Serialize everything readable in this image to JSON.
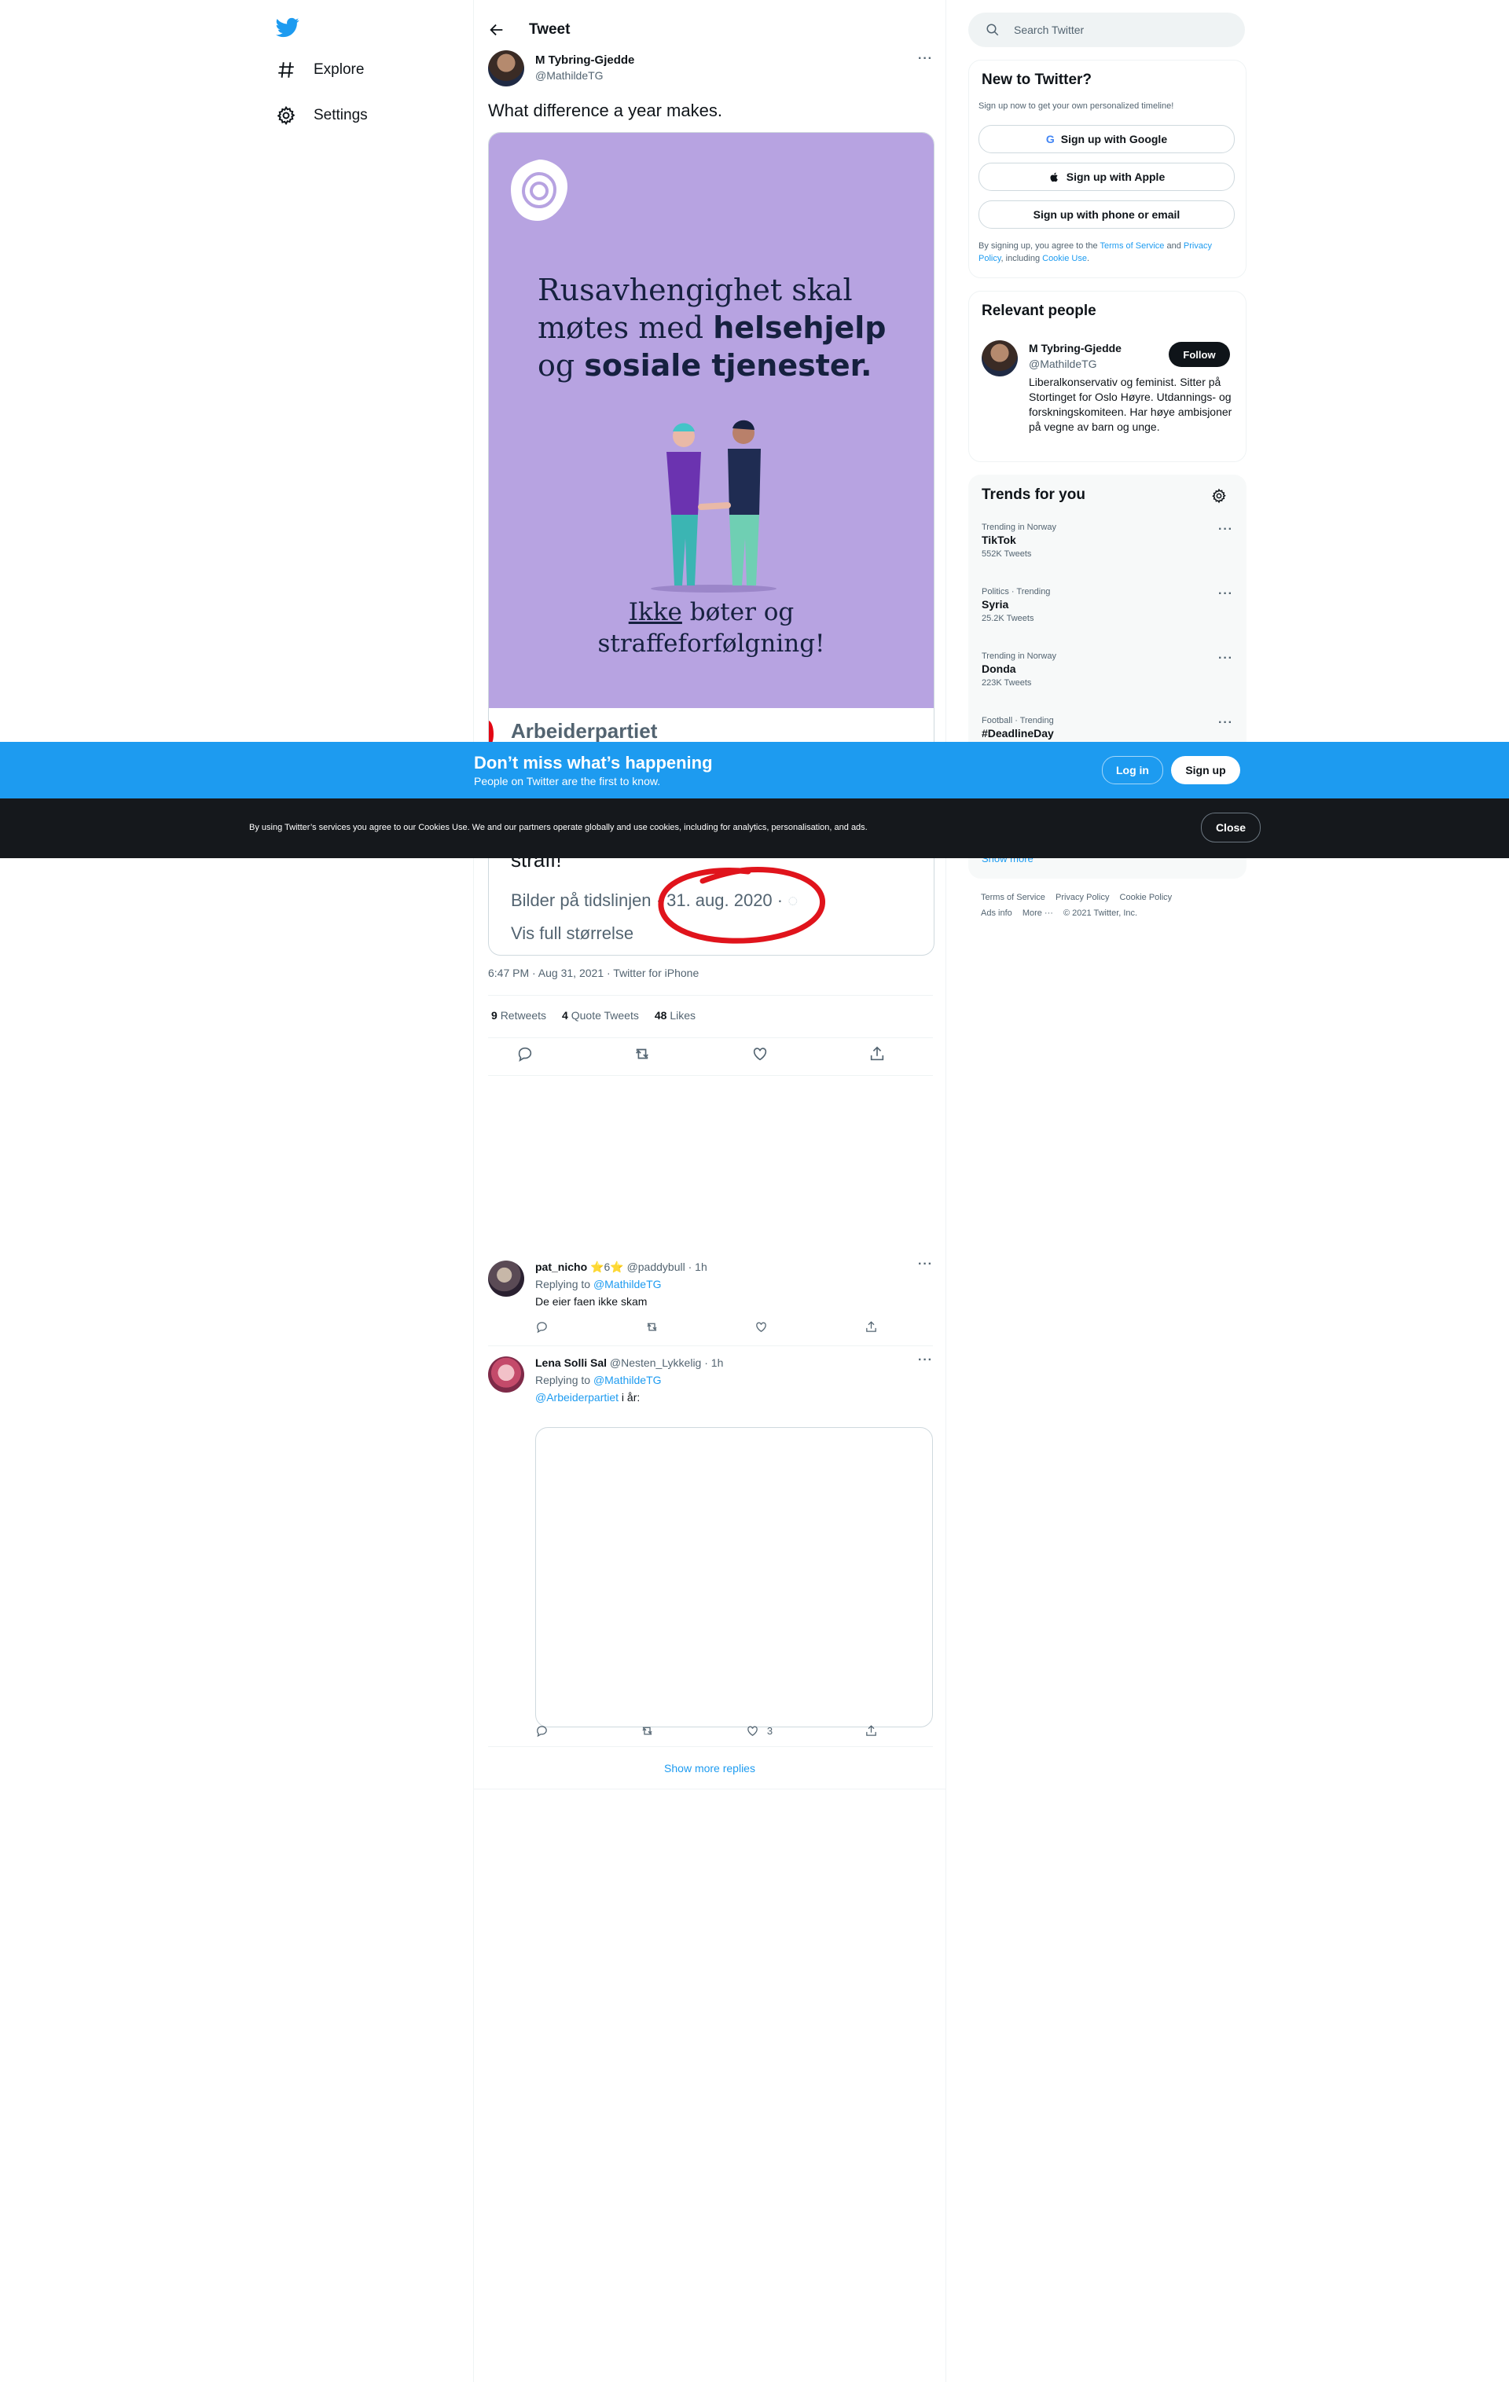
{
  "nav": {
    "explore": "Explore",
    "settings": "Settings"
  },
  "header": {
    "title": "Tweet"
  },
  "tweet": {
    "name": "M Tybring-Gjedde",
    "handle": "@MathildeTG",
    "text": "What difference a year makes.",
    "poster": {
      "line1": "Rusavhengighet skal",
      "line2a": "møtes med ",
      "line2b": "helsehjelp",
      "line3a": "og ",
      "line3b": "sosiale tjenester.",
      "bottom1": "Ikke",
      "bottom2": " bøter og",
      "bottom3": "straffeforfølgning!"
    },
    "card_title": "Arbeiderpartiet",
    "card_strafi": "straff!",
    "card_meta": "Bilder på tidslinjen · 31. aug. 2020 · ",
    "card_full": "Vis full størrelse",
    "timestamp": "6:47 PM · Aug 31, 2021 · Twitter for iPhone",
    "retweets": "9",
    "retweets_label": "Retweets",
    "quotes": "4",
    "quotes_label": "Quote Tweets",
    "likes": "48",
    "likes_label": "Likes"
  },
  "replies": [
    {
      "name": "pat_nicho",
      "badge": "⭐6⭐",
      "handle": "@paddybull",
      "time": "· 1h",
      "replying_prefix": "Replying to ",
      "replying_to": "@MathildeTG",
      "text": "De eier faen ikke skam"
    },
    {
      "name": "Lena Solli Sal",
      "handle": "@Nesten_Lykkelig",
      "time": "· 1h",
      "replying_prefix": "Replying to ",
      "replying_to": "@MathildeTG",
      "mention": "@Arbeiderpartiet",
      "text": " i år:",
      "likes": "3"
    }
  ],
  "show_more_replies": "Show more replies",
  "right": {
    "search_placeholder": "Search Twitter",
    "new_title": "New to Twitter?",
    "new_sub": "Sign up now to get your own personalized timeline!",
    "btn_google": "Sign up with Google",
    "btn_apple": "Sign up with Apple",
    "btn_phone": "Sign up with phone or email",
    "terms_pre": "By signing up, you agree to the ",
    "terms": "Terms of Service",
    "terms_and": " and ",
    "privacy": "Privacy Policy",
    "terms_incl": ", including ",
    "cookie": "Cookie Use",
    "terms_end": ".",
    "relevant_title": "Relevant people",
    "person_name": "M Tybring-Gjedde",
    "person_handle": "@MathildeTG",
    "follow": "Follow",
    "person_bio": "Liberalkonservativ og feminist. Sitter på Stortinget for Oslo Høyre. Utdannings- og forskningskomiteen. Har høye ambisjoner på vegne av barn og unge.",
    "trends_title": "Trends for you",
    "trends": [
      {
        "meta": "Trending in Norway",
        "name": "TikTok",
        "count": "552K Tweets"
      },
      {
        "meta": "Politics · Trending",
        "name": "Syria",
        "count": "25.2K Tweets"
      },
      {
        "meta": "Trending in Norway",
        "name": "Donda",
        "count": "223K Tweets"
      },
      {
        "meta": "Football · Trending",
        "name": "#DeadlineDay",
        "count": ""
      }
    ],
    "show_more": "Show more",
    "footer": [
      "Terms of Service",
      "Privacy Policy",
      "Cookie Policy",
      "Ads info",
      "More ···",
      "© 2021 Twitter, Inc."
    ]
  },
  "banner": {
    "title": "Don’t miss what’s happening",
    "sub": "People on Twitter are the first to know.",
    "login": "Log in",
    "signup": "Sign up"
  },
  "cookie_bar": {
    "text": "By using Twitter’s services you agree to our Cookies Use. We and our partners operate globally and use cookies, including for analytics, personalisation, and ads.",
    "close": "Close"
  }
}
